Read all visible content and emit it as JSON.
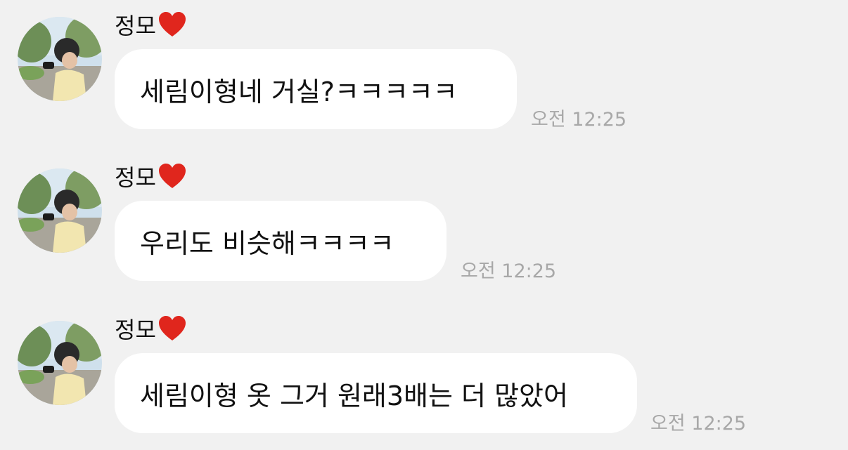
{
  "messages": [
    {
      "sender": "정모",
      "sender_badge_icon": "red-heart-icon",
      "text": "세림이형네 거실?ㅋㅋㅋㅋㅋ",
      "time": "오전 12:25"
    },
    {
      "sender": "정모",
      "sender_badge_icon": "red-heart-icon",
      "text": "우리도 비슷해ㅋㅋㅋㅋ",
      "time": "오전 12:25"
    },
    {
      "sender": "정모",
      "sender_badge_icon": "red-heart-icon",
      "text": "세림이형 옷 그거 원래3배는 더 많았어",
      "time": "오전 12:25"
    }
  ],
  "colors": {
    "background": "#f1f1f1",
    "bubble": "#ffffff",
    "text": "#111111",
    "timestamp": "#a8a8a8",
    "heart": "#e0261d"
  }
}
